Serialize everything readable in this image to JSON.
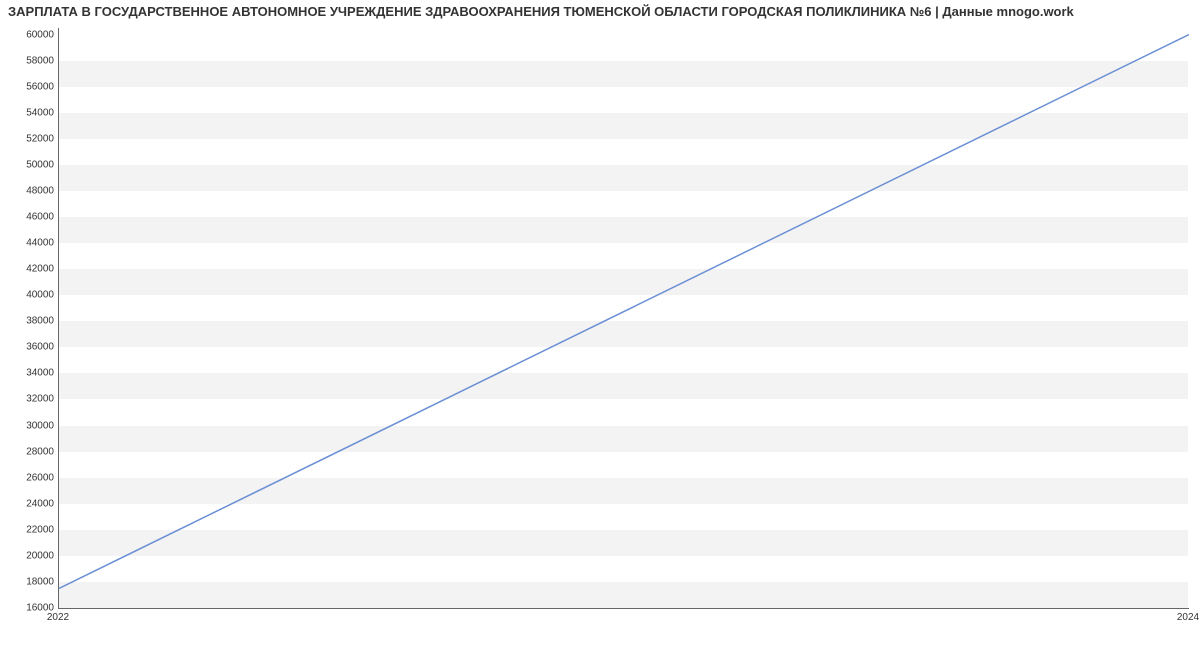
{
  "title": "ЗАРПЛАТА В ГОСУДАРСТВЕННОЕ АВТОНОМНОЕ УЧРЕЖДЕНИЕ ЗДРАВООХРАНЕНИЯ ТЮМЕНСКОЙ ОБЛАСТИ ГОРОДСКАЯ ПОЛИКЛИНИКА №6 | Данные mnogo.work",
  "chart_data": {
    "type": "line",
    "title": "ЗАРПЛАТА В ГОСУДАРСТВЕННОЕ АВТОНОМНОЕ УЧРЕЖДЕНИЕ ЗДРАВООХРАНЕНИЯ ТЮМЕНСКОЙ ОБЛАСТИ ГОРОДСКАЯ ПОЛИКЛИНИКА №6 | Данные mnogo.work",
    "xlabel": "",
    "ylabel": "",
    "x": [
      2022,
      2024
    ],
    "values": [
      17500,
      60000
    ],
    "x_ticks": [
      2022,
      2024
    ],
    "y_ticks": [
      16000,
      18000,
      20000,
      22000,
      24000,
      26000,
      28000,
      30000,
      32000,
      34000,
      36000,
      38000,
      40000,
      42000,
      44000,
      46000,
      48000,
      50000,
      52000,
      54000,
      56000,
      58000,
      60000
    ],
    "xlim": [
      2022,
      2024
    ],
    "ylim": [
      16000,
      60500
    ],
    "grid": true,
    "line_color": "#6a8fd4"
  }
}
